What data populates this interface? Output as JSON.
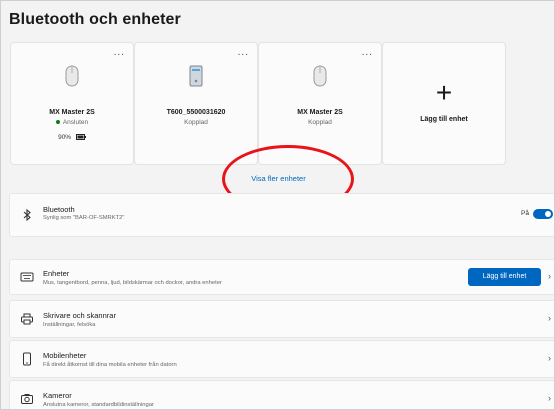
{
  "page": {
    "title": "Bluetooth och enheter"
  },
  "devices": [
    {
      "name": "MX Master 2S",
      "status": "Ansluten",
      "battery": "90%",
      "icon": "mouse-icon",
      "more": "..."
    },
    {
      "name": "T600_5500031620",
      "status": "Kopplad",
      "icon": "pc-tower-icon",
      "more": "..."
    },
    {
      "name": "MX Master 2S",
      "status": "Kopplad",
      "icon": "mouse-icon",
      "more": "..."
    }
  ],
  "add_card": {
    "label": "Lägg till enhet",
    "icon": "plus-icon"
  },
  "more_link": "Visa fler enheter",
  "bluetooth_row": {
    "title": "Bluetooth",
    "subtitle": "Synlig som \"BAR-OF-SMRKT2\"",
    "toggle_label": "På",
    "toggle_on": true,
    "icon": "bluetooth-icon"
  },
  "rows": [
    {
      "title": "Enheter",
      "subtitle": "Mus, tangentbord, penna, ljud, bildskärmar och dockor, andra enheter",
      "icon": "keyboard-icon",
      "button": "Lägg till enhet"
    },
    {
      "title": "Skrivare och skannrar",
      "subtitle": "Inställningar, felsöka",
      "icon": "printer-icon"
    },
    {
      "title": "Mobilenheter",
      "subtitle": "Få direkt åtkomst till dina mobila enheter från datorn",
      "icon": "phone-icon"
    },
    {
      "title": "Kameror",
      "subtitle": "Anslutna kameror, standardbildinställningar",
      "icon": "camera-icon"
    }
  ],
  "colors": {
    "accent": "#0067c0",
    "highlight_ring": "#e8141a",
    "connected_dot": "#107c10"
  }
}
